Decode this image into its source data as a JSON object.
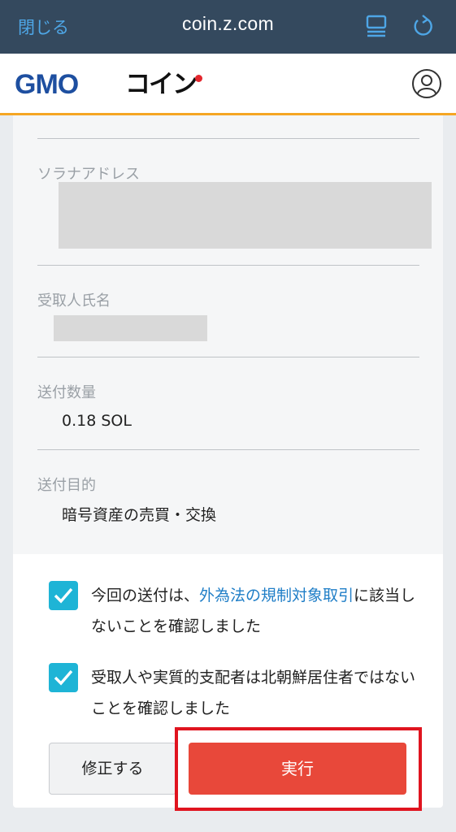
{
  "browser": {
    "close_label": "閉じる",
    "url": "coin.z.com",
    "bookmark_icon": "bookmark-icon",
    "reload_icon": "reload-icon"
  },
  "header": {
    "logo_gmo": "GMO",
    "logo_coin": "コイン",
    "user_icon": "user-icon",
    "accent_color": "#f5a623"
  },
  "fields": [
    {
      "label": "ソラナアドレス",
      "value": ""
    },
    {
      "label": "受取人氏名",
      "value": ""
    },
    {
      "label": "送付数量",
      "value": "0.18 SOL"
    },
    {
      "label": "送付目的",
      "value": "暗号資産の売買・交換"
    }
  ],
  "confirmations": [
    {
      "checked": true,
      "text_before": "今回の送付は、",
      "link": "外為法の規制対象取引",
      "text_after": "に該当しないことを確認しました"
    },
    {
      "checked": true,
      "text_before": "受取人や実質的支配者は北朝鮮居住者ではないことを確認しました",
      "link": "",
      "text_after": ""
    }
  ],
  "buttons": {
    "edit_label": "修正する",
    "execute_label": "実行"
  },
  "colors": {
    "topbar": "#34495e",
    "checkbox": "#1eb4d6",
    "execute": "#e8483a",
    "highlight": "#e0141f"
  }
}
